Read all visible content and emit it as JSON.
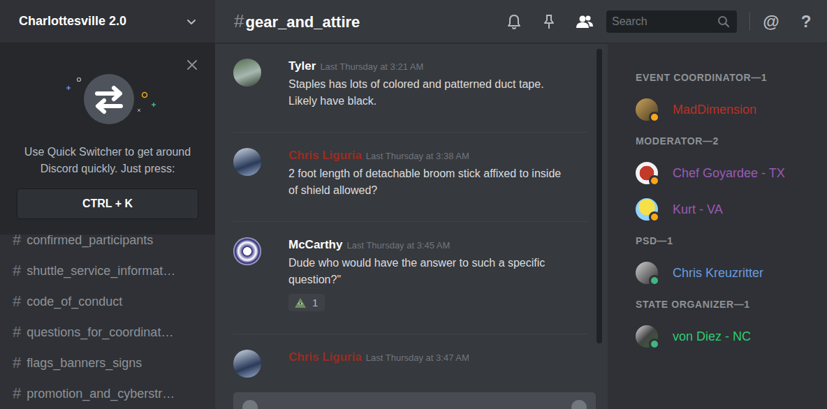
{
  "server": {
    "name": "Charlottesville 2.0"
  },
  "quick_switcher": {
    "message": "Use Quick Switcher to get around Discord quickly. Just press:",
    "shortcut": "CTRL + K"
  },
  "channel_prefix": "#",
  "channels": [
    {
      "name": "confirmed_participants",
      "selected": false
    },
    {
      "name": "shuttle_service_informat…",
      "selected": false
    },
    {
      "name": "code_of_conduct",
      "selected": false
    },
    {
      "name": "questions_for_coordinat…",
      "selected": false
    },
    {
      "name": "flags_banners_signs",
      "selected": false
    },
    {
      "name": "promotion_and_cyberstr…",
      "selected": false
    }
  ],
  "channel_header": {
    "name": "gear_and_attire"
  },
  "search": {
    "placeholder": "Search"
  },
  "member_list_open": true,
  "mentions_icon": "@",
  "help_icon": "?",
  "messages": [
    {
      "author": "Tyler",
      "color": "#ffffff",
      "time": "Last Thursday at 3:21 AM",
      "text": "Staples has lots of colored and patterned duct tape. Likely have black.",
      "reactions": []
    },
    {
      "author": "Chris Liguria",
      "color": "#992d22",
      "time": "Last Thursday at 3:38 AM",
      "text": "2 foot length of detachable broom stick affixed to inside of shield allowed?",
      "reactions": []
    },
    {
      "author": "McCarthy",
      "color": "#ffffff",
      "time": "Last Thursday at 3:45 AM",
      "text": "Dude who would have the answer to such a specific question?\"",
      "reactions": [
        {
          "count": "1"
        }
      ]
    },
    {
      "author": "Chris Liguria",
      "color": "#992d22",
      "time": "Last Thursday at 3:47 AM",
      "reactions": []
    }
  ],
  "member_groups": [
    {
      "label": "EVENT COORDINATOR—1",
      "members": [
        {
          "name": "MadDimension",
          "color": "#b83227",
          "status": "idle"
        }
      ]
    },
    {
      "label": "MODERATOR—2",
      "members": [
        {
          "name": "Chef Goyardee - TX",
          "color": "#9b59b6",
          "status": "idle"
        },
        {
          "name": "Kurt - VA",
          "color": "#9b59b6",
          "status": "idle"
        }
      ]
    },
    {
      "label": "PSD—1",
      "members": [
        {
          "name": "Chris Kreuzritter",
          "color": "#6a9be0",
          "status": "online"
        }
      ]
    },
    {
      "label": "STATE ORGANIZER—1",
      "members": [
        {
          "name": "von Diez - NC",
          "color": "#2ecc71",
          "status": "online"
        }
      ]
    }
  ]
}
